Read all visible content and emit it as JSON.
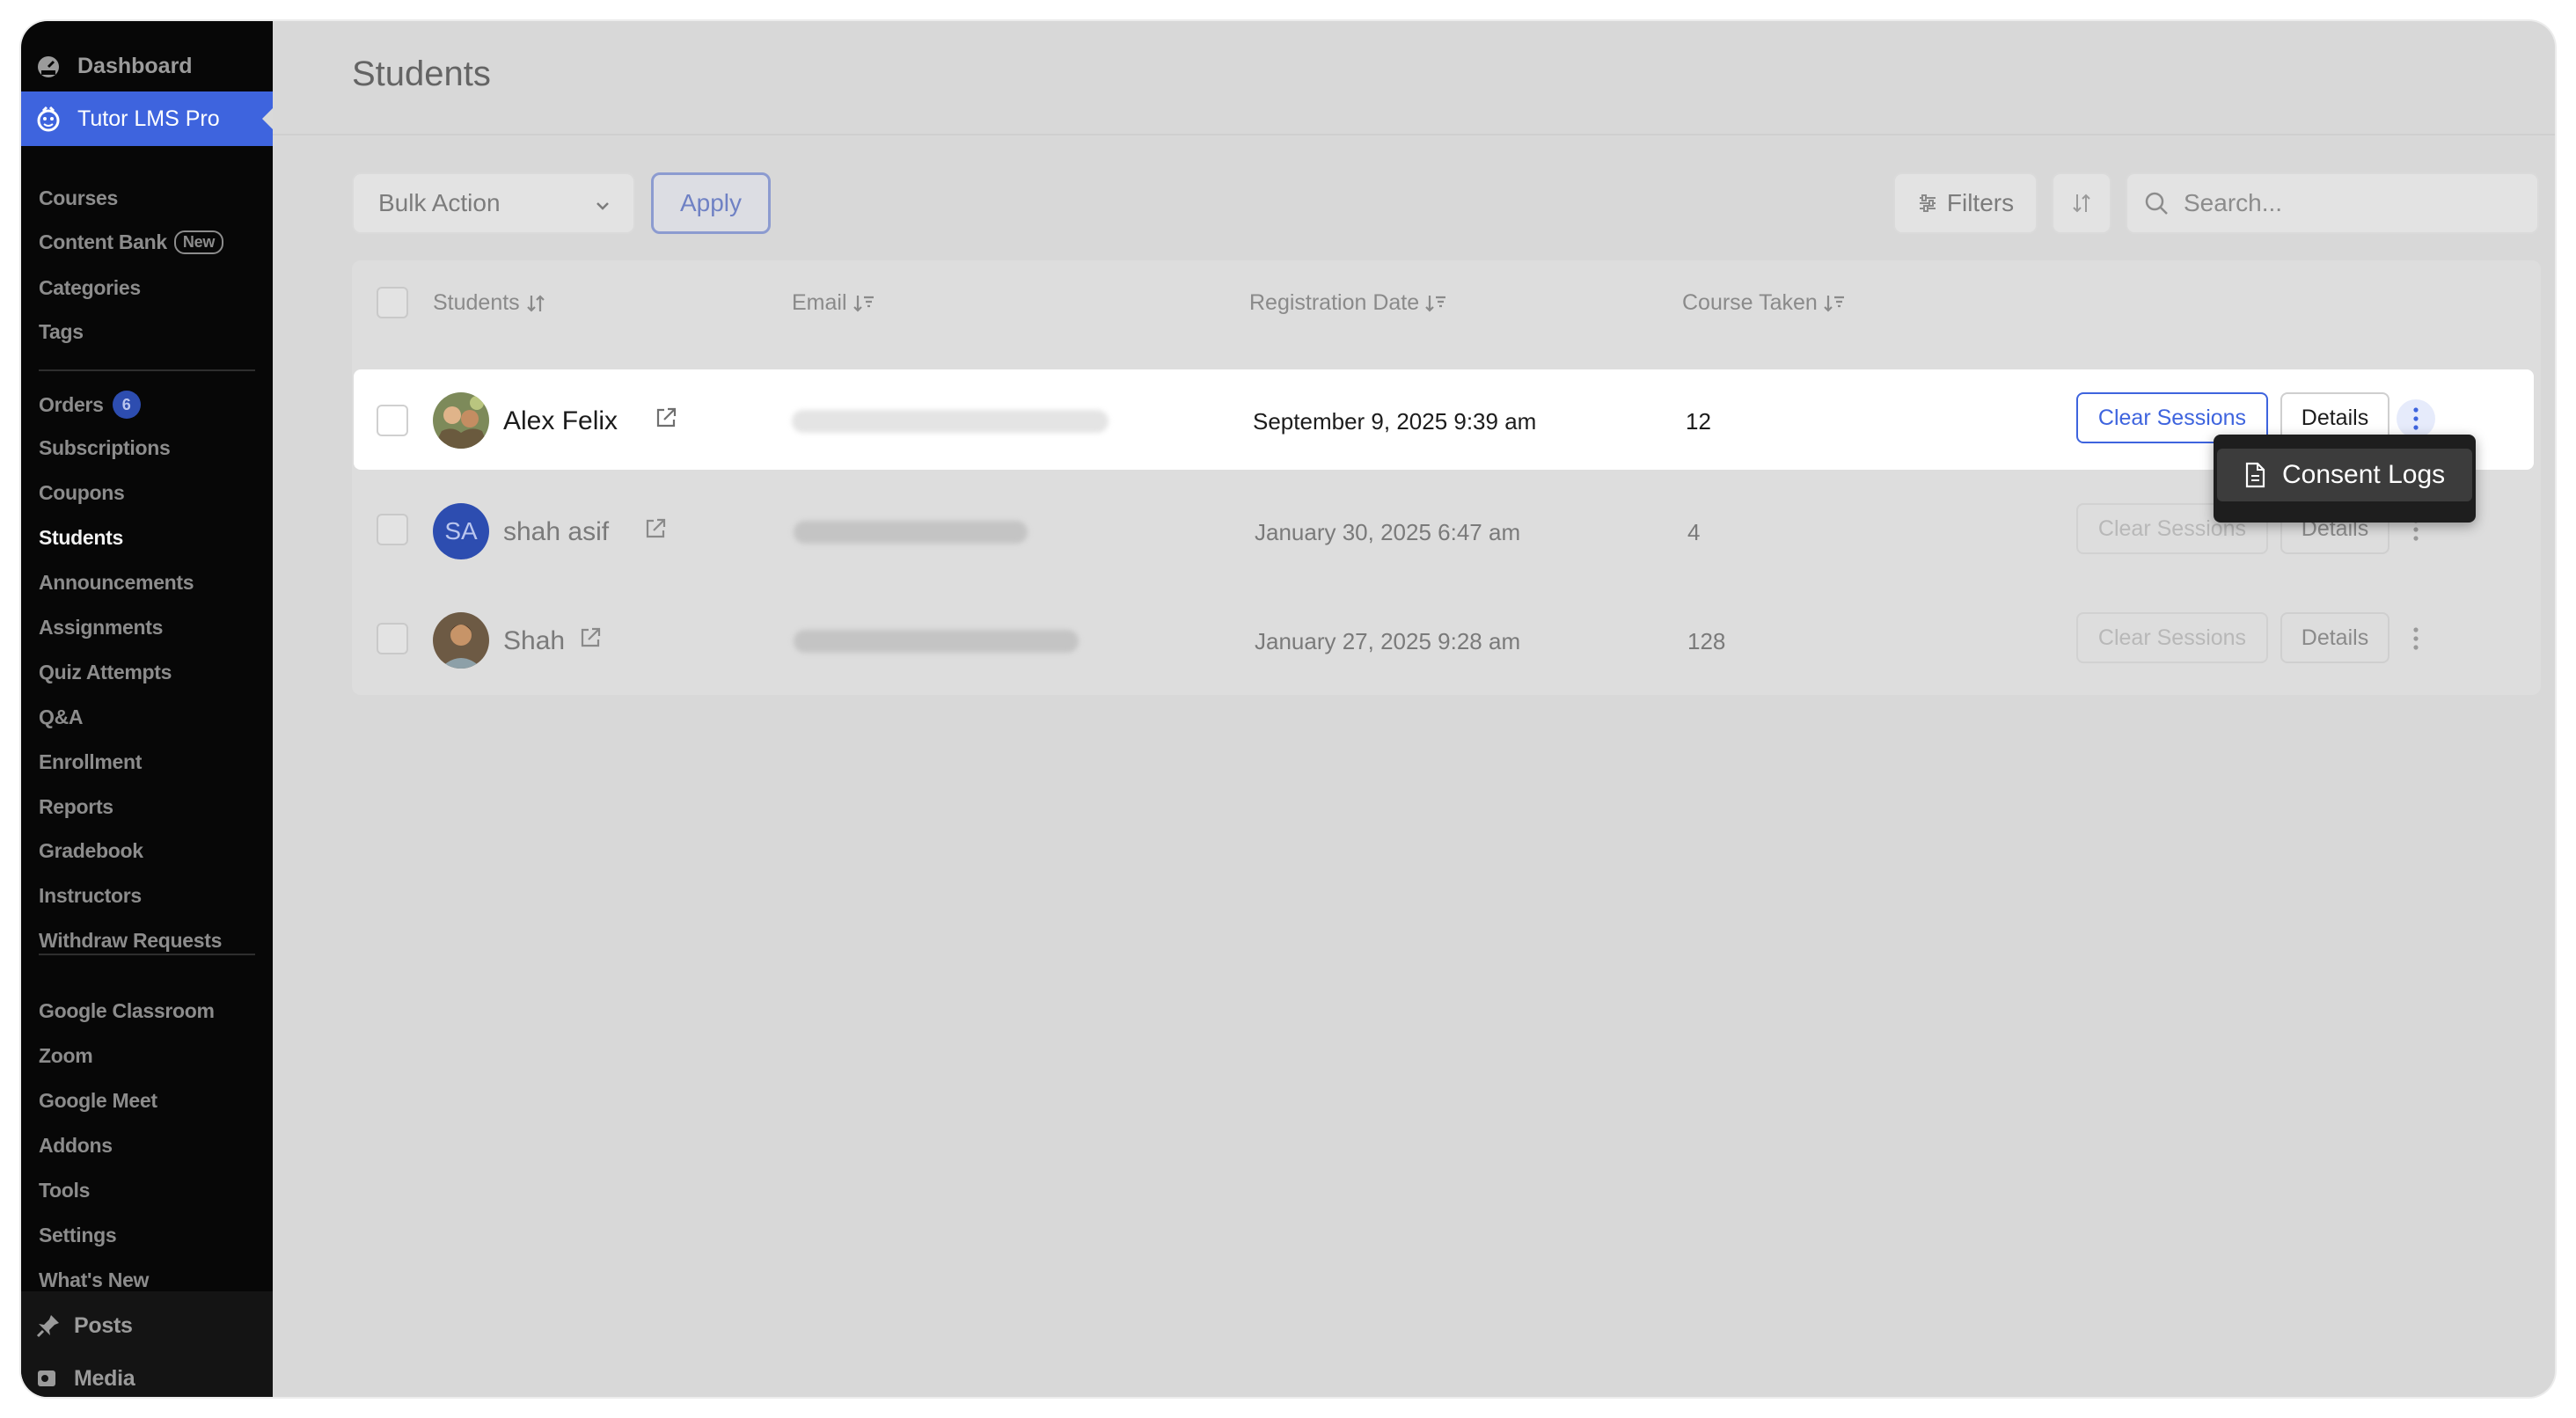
{
  "sidebar": {
    "dashboard": "Dashboard",
    "plugin": "Tutor LMS Pro",
    "group1": [
      {
        "label": "Courses"
      },
      {
        "label": "Content Bank",
        "badge": "New"
      },
      {
        "label": "Categories"
      },
      {
        "label": "Tags"
      }
    ],
    "group2": [
      {
        "label": "Orders",
        "count": "6"
      },
      {
        "label": "Subscriptions"
      },
      {
        "label": "Coupons"
      },
      {
        "label": "Students",
        "active": true
      },
      {
        "label": "Announcements"
      },
      {
        "label": "Assignments"
      },
      {
        "label": "Quiz Attempts"
      },
      {
        "label": "Q&A"
      },
      {
        "label": "Enrollment"
      },
      {
        "label": "Reports"
      },
      {
        "label": "Gradebook"
      },
      {
        "label": "Instructors"
      },
      {
        "label": "Withdraw Requests"
      }
    ],
    "group3": [
      {
        "label": "Google Classroom"
      },
      {
        "label": "Zoom"
      },
      {
        "label": "Google Meet"
      },
      {
        "label": "Addons"
      },
      {
        "label": "Tools"
      },
      {
        "label": "Settings"
      },
      {
        "label": "What's New"
      }
    ],
    "posts": "Posts",
    "media": "Media"
  },
  "page": {
    "title": "Students"
  },
  "toolbar": {
    "bulk_action": "Bulk Action",
    "apply": "Apply",
    "filters": "Filters",
    "search_placeholder": "Search..."
  },
  "table": {
    "columns": {
      "students": "Students",
      "email": "Email",
      "registration_date": "Registration Date",
      "course_taken": "Course Taken"
    },
    "rows": [
      {
        "name": "Alex Felix",
        "date": "September 9, 2025 9:39 am",
        "courses": "12",
        "clear": "Clear Sessions",
        "details": "Details"
      },
      {
        "name": "shah asif",
        "initials": "SA",
        "date": "January 30, 2025 6:47 am",
        "courses": "4",
        "clear": "Clear Sessions",
        "details": "Details"
      },
      {
        "name": "Shah",
        "date": "January 27, 2025 9:28 am",
        "courses": "128",
        "clear": "Clear Sessions",
        "details": "Details"
      }
    ]
  },
  "dropdown": {
    "consent_logs": "Consent Logs"
  },
  "colors": {
    "accent": "#3e64de",
    "sidebar_bg": "#070707",
    "overlay_bg": "#d8d8d8"
  }
}
